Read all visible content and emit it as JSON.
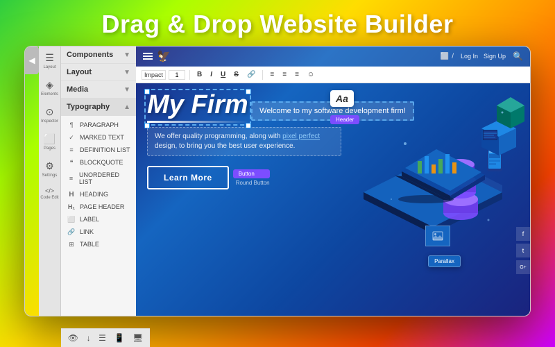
{
  "title": "Drag & Drop Website Builder",
  "sidebar": {
    "back_icon": "◀",
    "panels": [
      {
        "id": "components",
        "label": "Components",
        "expanded": false
      },
      {
        "id": "layout",
        "label": "Layout",
        "expanded": false
      },
      {
        "id": "media",
        "label": "Media",
        "expanded": false
      },
      {
        "id": "typography",
        "label": "Typography",
        "expanded": true
      }
    ],
    "typography_items": [
      {
        "icon": "¶",
        "label": "PARAGRAPH"
      },
      {
        "icon": "✓",
        "label": "MARKED TEXT"
      },
      {
        "icon": "≡",
        "label": "DEFINITION LIST"
      },
      {
        "icon": "❝",
        "label": "BLOCKQUOTE"
      },
      {
        "icon": "≡",
        "label": "UNORDERED LIST"
      },
      {
        "icon": "H",
        "label": "HEADING"
      },
      {
        "icon": "H₁",
        "label": "PAGE HEADER"
      },
      {
        "icon": "⬜",
        "label": "LABEL"
      },
      {
        "icon": "🔗",
        "label": "LINK"
      },
      {
        "icon": "⊞",
        "label": "TABLE"
      }
    ],
    "icon_labels": [
      {
        "icon": "☰",
        "label": "Layout"
      },
      {
        "icon": "◈",
        "label": "Elements"
      },
      {
        "icon": "⊙",
        "label": "Inspector"
      },
      {
        "icon": "⬜",
        "label": "Pages"
      },
      {
        "icon": "⚙",
        "label": "Settings"
      },
      {
        "icon": "</>",
        "label": "Code Edit"
      }
    ],
    "bottom_icons": [
      "👁",
      "↓",
      "☰",
      "📱",
      "🖥"
    ]
  },
  "canvas": {
    "nav": {
      "logo": "🦅",
      "links": [
        "Log In",
        "Sign Up"
      ],
      "search_icon": "🔍"
    },
    "edit_toolbar": {
      "font": "Impact",
      "size": "1",
      "bold": "B",
      "italic": "I",
      "underline": "U",
      "strikethrough": "S",
      "link": "🔗",
      "align_left": "≡",
      "align_center": "≡",
      "align_right": "≡",
      "emoji": "☺"
    },
    "content": {
      "site_title": "My Firm",
      "typography_label": "Aa",
      "header_badge": "Header",
      "welcome_text": "Welcome to my software development firm!",
      "description_text": "We offer quality programming, along with ",
      "description_highlight": "pixel perfect",
      "description_rest": "\ndesign, to bring you the best user experience.",
      "learn_more": "Learn More",
      "button_badge": "Button",
      "round_button_label": "Round Button"
    },
    "parallax_badge": "Parallax",
    "social": [
      "f",
      "t",
      "G+"
    ]
  },
  "colors": {
    "background_gradient_start": "#2ecc40",
    "background_gradient_end": "#cc00ff",
    "canvas_bg_start": "#1a237e",
    "canvas_bg_end": "#0d47a1",
    "accent_purple": "#7c4dff",
    "accent_blue": "#2196f3"
  }
}
